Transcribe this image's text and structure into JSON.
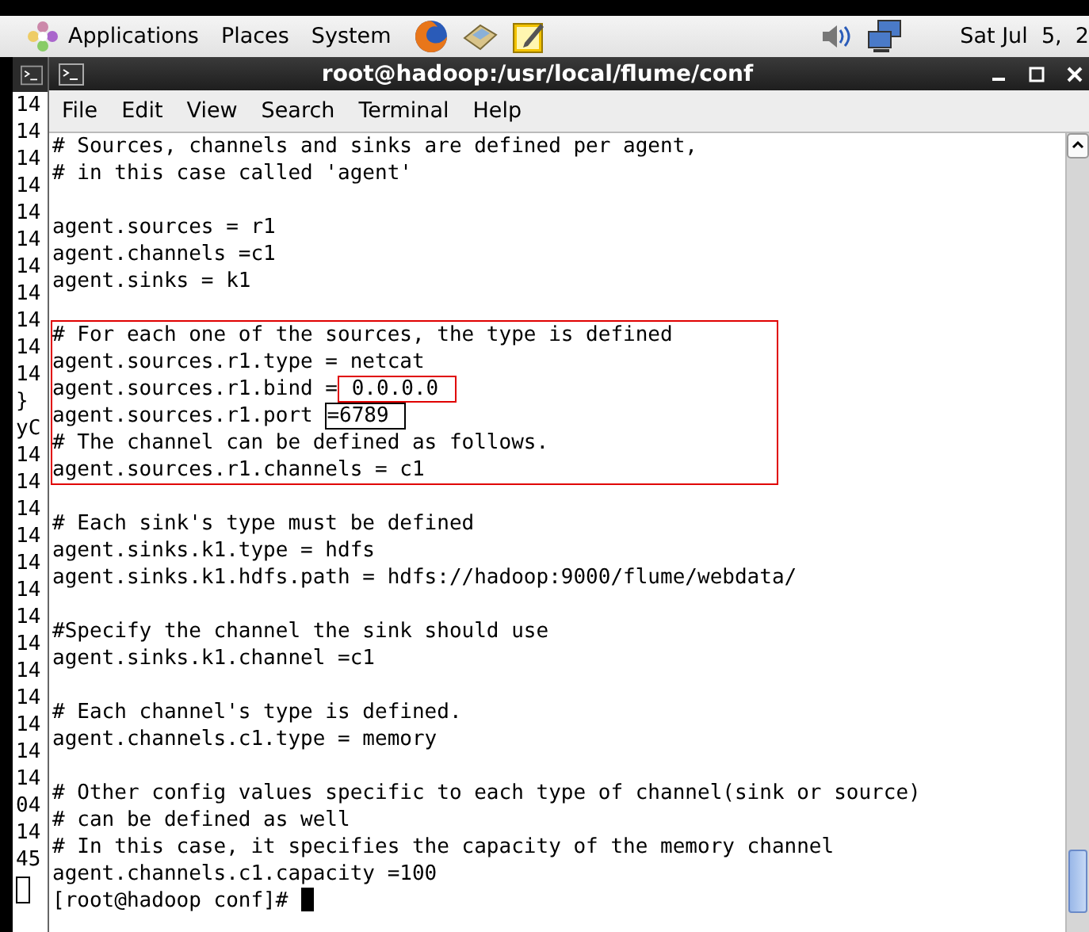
{
  "top_panel": {
    "menus": [
      "Applications",
      "Places",
      "System"
    ],
    "clock": "Sat Jul  5,  2"
  },
  "background_terminal": {
    "lines": [
      "14",
      "14",
      "14",
      "14",
      "14",
      "14",
      "14",
      "14",
      "14",
      "14",
      "14",
      "}",
      "yC",
      "14",
      "14",
      "14",
      "14",
      "14",
      "14",
      "14",
      "14",
      "14",
      "14",
      "14",
      "14",
      "14",
      "04",
      "14",
      "45"
    ]
  },
  "window": {
    "title": "root@hadoop:/usr/local/flume/conf",
    "menu": [
      "File",
      "Edit",
      "View",
      "Search",
      "Terminal",
      "Help"
    ],
    "blocks": [
      {
        "lines": [
          "# Sources, channels and sinks are defined per agent,",
          "# in this case called 'agent'"
        ]
      },
      {
        "lines": [
          "agent.sources = r1",
          "agent.channels =c1",
          "agent.sinks = k1"
        ]
      },
      {
        "color": "#e00000",
        "lines": [
          "# For each one of the sources, the type is defined",
          "agent.sources.r1.type = netcat",
          {
            "text": "agent.sources.r1.bind =",
            "highlight": {
              "text": " 0.0.0.0",
              "color": "#e00000"
            }
          },
          {
            "text": "agent.sources.r1.port ",
            "highlight": {
              "text": "=6789",
              "color": "#000000"
            }
          },
          "# The channel can be defined as follows.",
          "agent.sources.r1.channels = c1"
        ]
      },
      {
        "lines": [
          "# Each sink's type must be defined",
          "agent.sinks.k1.type = hdfs",
          "agent.sinks.k1.hdfs.path = hdfs://hadoop:9000/flume/webdata/"
        ]
      },
      {
        "lines": [
          "#Specify the channel the sink should use",
          "agent.sinks.k1.channel =c1"
        ]
      },
      {
        "lines": [
          "# Each channel's type is defined.",
          "agent.channels.c1.type = memory"
        ]
      },
      {
        "lines": [
          "# Other config values specific to each type of channel(sink or source)",
          "# can be defined as well",
          "# In this case, it specifies the capacity of the memory channel",
          "agent.channels.c1.capacity =100"
        ]
      }
    ],
    "prompt": "[root@hadoop conf]# "
  }
}
